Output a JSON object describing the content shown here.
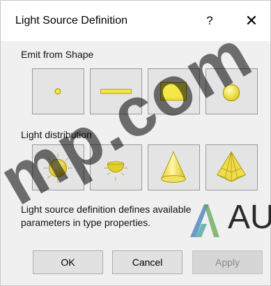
{
  "dialog": {
    "title": "Light Source Definition",
    "help_label": "?",
    "close_label": "✕"
  },
  "emit": {
    "label": "Emit from Shape",
    "options": [
      {
        "icon": "point-shape-icon"
      },
      {
        "icon": "line-shape-icon"
      },
      {
        "icon": "rectangle-shape-icon"
      },
      {
        "icon": "circle-shape-icon"
      }
    ]
  },
  "distribution": {
    "label": "Light distribution",
    "options": [
      {
        "icon": "spherical-distribution-icon"
      },
      {
        "icon": "hemispherical-distribution-icon"
      },
      {
        "icon": "spot-distribution-icon"
      },
      {
        "icon": "photometric-web-distribution-icon"
      }
    ]
  },
  "description": "Light source definition defines available parameters in type properties.",
  "buttons": {
    "ok": "OK",
    "cancel": "Cancel",
    "apply": "Apply"
  },
  "watermark": {
    "text": "mp.com",
    "brand": "AU"
  },
  "colors": {
    "shape_fill": "#f5e84a",
    "shape_stroke": "#a89a10"
  }
}
